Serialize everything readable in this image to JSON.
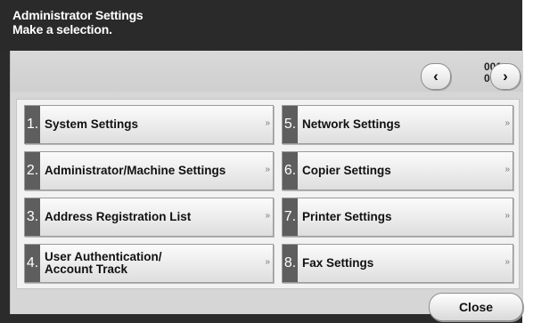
{
  "header": {
    "title": "Administrator Settings",
    "subtitle": "Make a selection."
  },
  "pager": {
    "current": "001",
    "total": "002",
    "prev_glyph": "‹",
    "next_glyph": "›"
  },
  "menu": {
    "arrow_glyph": "»",
    "items": [
      {
        "num": "1.",
        "label": "System Settings"
      },
      {
        "num": "2.",
        "label": "Administrator/Machine Settings"
      },
      {
        "num": "3.",
        "label": "Address Registration List"
      },
      {
        "num": "4.",
        "label": "User Authentication/\nAccount Track"
      },
      {
        "num": "5.",
        "label": "Network Settings"
      },
      {
        "num": "6.",
        "label": "Copier Settings"
      },
      {
        "num": "7.",
        "label": "Printer Settings"
      },
      {
        "num": "8.",
        "label": "Fax Settings"
      }
    ]
  },
  "footer": {
    "close_label": "Close"
  },
  "icons": {
    "prev": "chevron-left-icon",
    "next": "chevron-right-icon",
    "item_arrow": "double-chevron-right-icon"
  }
}
